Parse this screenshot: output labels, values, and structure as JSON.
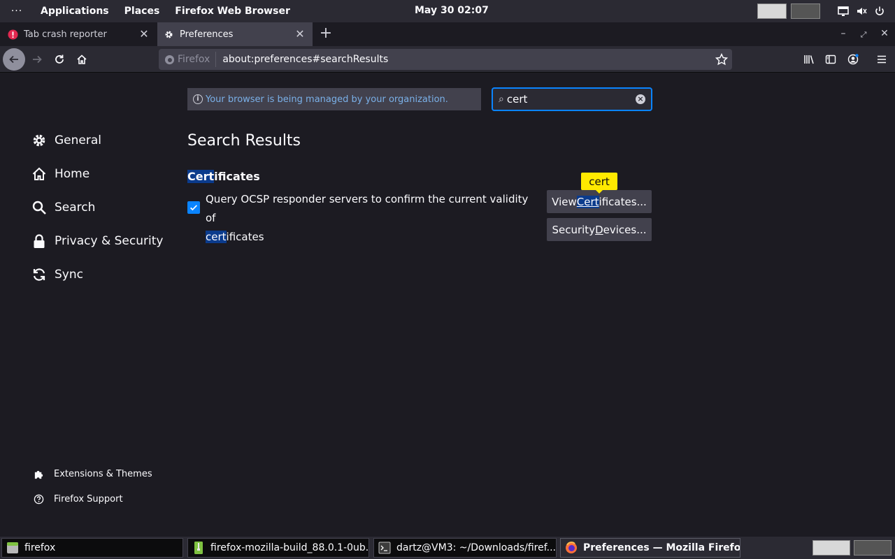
{
  "topbar": {
    "dots": "···",
    "menus": [
      "Applications",
      "Places",
      "Firefox Web Browser"
    ],
    "clock": "May 30  02:07"
  },
  "tabs": [
    {
      "label": "Tab crash reporter",
      "icon": "error-icon"
    },
    {
      "label": "Preferences",
      "icon": "gear-icon"
    }
  ],
  "urlbar": {
    "identity": "Firefox",
    "url": "about:preferences#searchResults"
  },
  "policy_notice": "Your browser is being managed by your organization.",
  "search": {
    "value": "cert"
  },
  "categories": [
    {
      "label": "General",
      "icon": "gear-icon"
    },
    {
      "label": "Home",
      "icon": "home-icon"
    },
    {
      "label": "Search",
      "icon": "search-icon"
    },
    {
      "label": "Privacy & Security",
      "icon": "lock-icon"
    },
    {
      "label": "Sync",
      "icon": "sync-icon"
    }
  ],
  "footer_links": [
    {
      "label": "Extensions & Themes",
      "icon": "puzzle-icon"
    },
    {
      "label": "Firefox Support",
      "icon": "help-icon"
    }
  ],
  "results": {
    "title": "Search Results",
    "section": {
      "hl": "Cert",
      "rest": "ificates"
    },
    "ocsp": {
      "checked": true,
      "line1": "Query OCSP responder servers to confirm the current validity of",
      "hl": "cert",
      "rest": "ificates"
    },
    "tooltip": "cert",
    "view_button": {
      "pre": "View ",
      "hl": "Cert",
      "post": "ificates..."
    },
    "devices_button": {
      "pre": "Security ",
      "u": "D",
      "post": "evices..."
    }
  },
  "taskbar": [
    {
      "label": "firefox",
      "icon": "folder-icon"
    },
    {
      "label": "firefox-mozilla-build_88.0.1-0ub...",
      "icon": "archive-icon"
    },
    {
      "label": "dartz@VM3: ~/Downloads/firef...",
      "icon": "terminal-icon"
    },
    {
      "label": "Preferences — Mozilla Firefox",
      "icon": "firefox-icon"
    }
  ],
  "colors": {
    "accent": "#0a84ff",
    "highlight": "#0b3b8c",
    "tooltip": "#ffe900",
    "background": "#1c1b22"
  }
}
